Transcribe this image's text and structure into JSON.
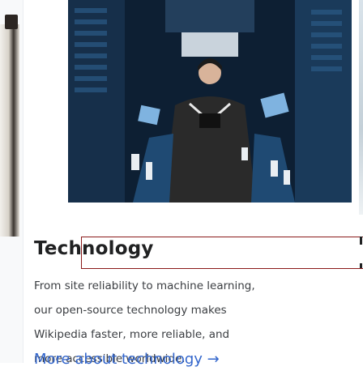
{
  "card": {
    "heading": "Technology",
    "description_lines": [
      "From site reliability to machine learning,",
      "our open-source technology makes",
      "Wikipedia faster, more reliable, and",
      "more accessible worldwide."
    ],
    "link_label": "More about technology →"
  },
  "colors": {
    "heading_border": "#8a1a1a",
    "link": "#3366cc",
    "text": "#3a3d41"
  }
}
